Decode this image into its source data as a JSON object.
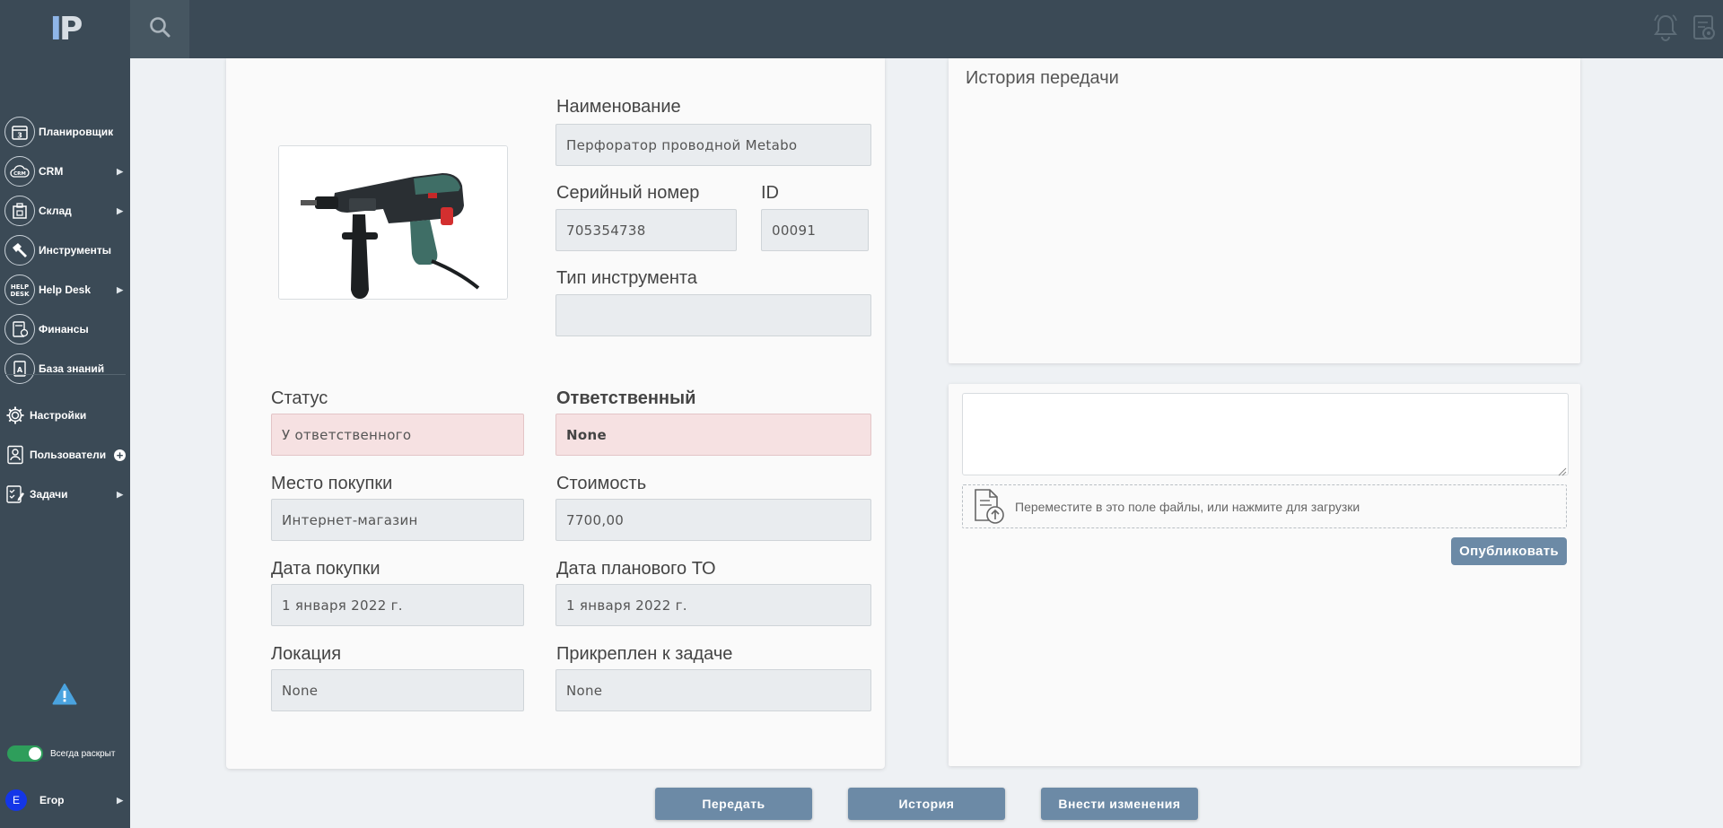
{
  "app": {
    "logo_text": "IP"
  },
  "topbar": {
    "icons": [
      "search-icon",
      "bell-icon",
      "settings-doc-icon"
    ]
  },
  "sidebar": {
    "items": [
      {
        "label": "Планировщик",
        "icon": "calendar-icon",
        "has_submenu": false
      },
      {
        "label": "CRM",
        "icon": "crm-cloud-icon",
        "has_submenu": true
      },
      {
        "label": "Склад",
        "icon": "warehouse-icon",
        "has_submenu": true
      },
      {
        "label": "Инструменты",
        "icon": "wrench-icon",
        "has_submenu": false
      },
      {
        "label": "Help Desk",
        "icon": "helpdesk-icon",
        "has_submenu": true
      },
      {
        "label": "Финансы",
        "icon": "finance-icon",
        "has_submenu": false
      },
      {
        "label": "База знаний",
        "icon": "knowledge-base-icon",
        "has_submenu": false
      },
      {
        "label": "Настройки",
        "icon": "gear-icon",
        "has_submenu": false
      },
      {
        "label": "Пользователи",
        "icon": "users-icon",
        "has_submenu": false
      },
      {
        "label": "Задачи",
        "icon": "tasks-icon",
        "has_submenu": true
      }
    ],
    "toggle_label": "Всегда раскрыт",
    "toggle_on": true,
    "user": {
      "initial": "E",
      "name": "Егор"
    }
  },
  "form": {
    "name_label": "Наименование",
    "name_value": "Перфоратор проводной Metabo",
    "serial_label": "Серийный номер",
    "serial_value": "705354738",
    "id_label": "ID",
    "id_value": "00091",
    "type_label": "Тип инструмента",
    "type_value": "",
    "status_label": "Статус",
    "status_value": "У ответственного",
    "responsible_label": "Ответственный",
    "responsible_value": "None",
    "purchase_place_label": "Место покупки",
    "purchase_place_value": "Интернет-магазин",
    "cost_label": "Стоимость",
    "cost_value": "7700,00",
    "purchase_date_label": "Дата покупки",
    "purchase_date_value": "1 января 2022 г.",
    "maintenance_date_label": "Дата планового ТО",
    "maintenance_date_value": "1 января 2022 г.",
    "location_label": "Локация",
    "location_value": "None",
    "task_label": "Прикреплен к задаче",
    "task_value": "None"
  },
  "history": {
    "title": "История передачи"
  },
  "comment": {
    "text": "",
    "dropzone_text": "Переместите в это поле файлы, или нажмите для загрузки",
    "publish_label": "Опубликовать"
  },
  "actions": {
    "transfer_label": "Передать",
    "history_label": "История",
    "edit_label": "Внести изменения"
  },
  "colors": {
    "sidebar_bg": "#3b4a56",
    "button_bg": "#6c8aa6",
    "status_bg": "#f6e1e2",
    "toggle_on": "#2e9e5b",
    "avatar": "#1436e8"
  }
}
